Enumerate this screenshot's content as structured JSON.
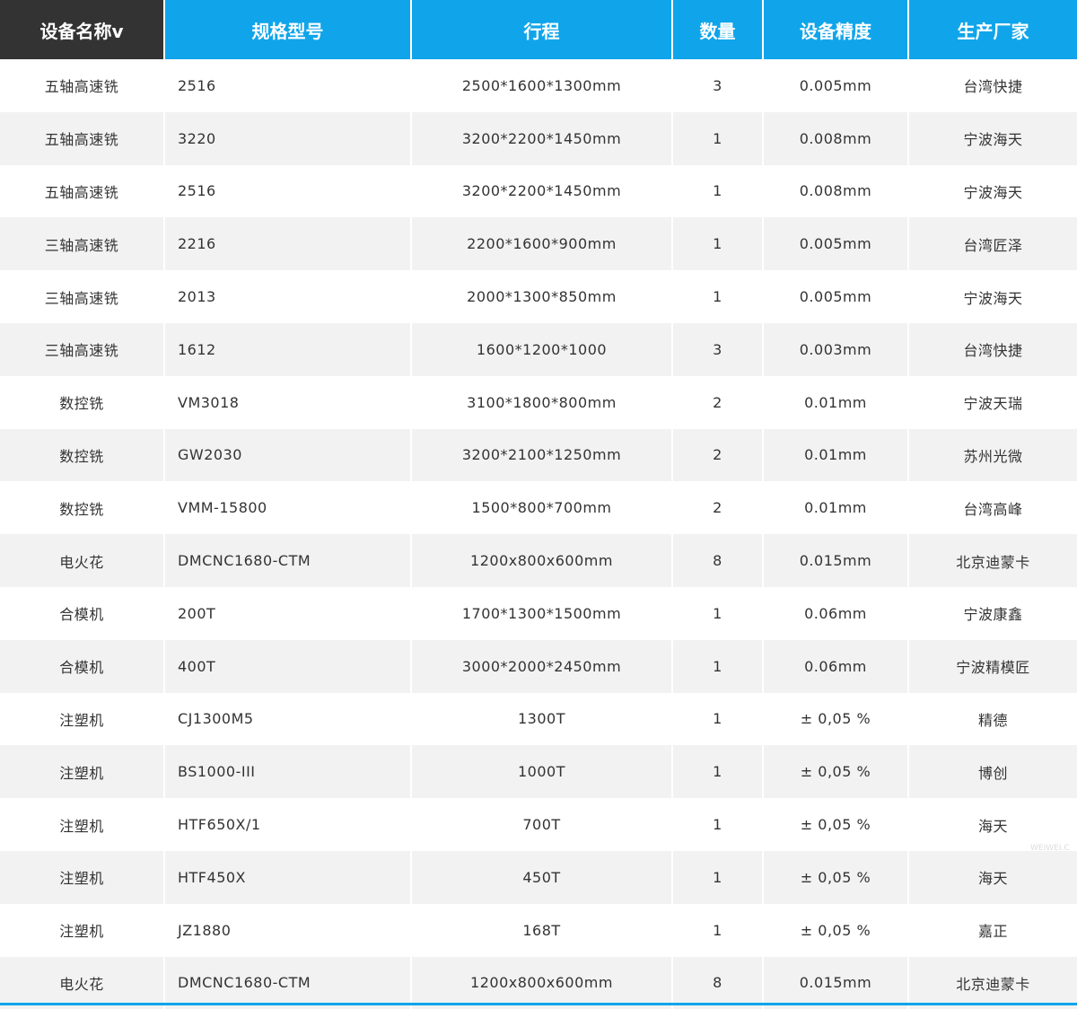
{
  "table": {
    "headers": [
      "设备名称v",
      "规格型号",
      "行程",
      "数量",
      "设备精度",
      "生产厂家"
    ],
    "rows": [
      [
        "五轴高速铣",
        "2516",
        "2500*1600*1300mm",
        "3",
        "0.005mm",
        "台湾快捷"
      ],
      [
        "五轴高速铣",
        "3220",
        "3200*2200*1450mm",
        "1",
        "0.008mm",
        "宁波海天"
      ],
      [
        "五轴高速铣",
        "2516",
        "3200*2200*1450mm",
        "1",
        "0.008mm",
        "宁波海天"
      ],
      [
        "三轴高速铣",
        "2216",
        "2200*1600*900mm",
        "1",
        "0.005mm",
        "台湾匠泽"
      ],
      [
        "三轴高速铣",
        "2013",
        "2000*1300*850mm",
        "1",
        "0.005mm",
        "宁波海天"
      ],
      [
        "三轴高速铣",
        "1612",
        "1600*1200*1000",
        "3",
        "0.003mm",
        "台湾快捷"
      ],
      [
        "数控铣",
        "VM3018",
        "3100*1800*800mm",
        "2",
        "0.01mm",
        "宁波天瑞"
      ],
      [
        "数控铣",
        "GW2030",
        "3200*2100*1250mm",
        "2",
        "0.01mm",
        "苏州光微"
      ],
      [
        "数控铣",
        "VMM-15800",
        "1500*800*700mm",
        "2",
        "0.01mm",
        "台湾高峰"
      ],
      [
        "电火花",
        "DMCNC1680-CTM",
        "1200x800x600mm",
        "8",
        "0.015mm",
        "北京迪蒙卡"
      ],
      [
        "合模机",
        "200T",
        "1700*1300*1500mm",
        "1",
        "0.06mm",
        "宁波康鑫"
      ],
      [
        "合模机",
        "400T",
        "3000*2000*2450mm",
        "1",
        "0.06mm",
        "宁波精模匠"
      ],
      [
        "注塑机",
        "CJ1300M5",
        "1300T",
        "1",
        "± 0,05 %",
        "精德"
      ],
      [
        "注塑机",
        "BS1000-III",
        "1000T",
        "1",
        "± 0,05 %",
        "博创"
      ],
      [
        "注塑机",
        "HTF650X/1",
        "700T",
        "1",
        "± 0,05 %",
        "海天"
      ],
      [
        "注塑机",
        "HTF450X",
        "450T",
        "1",
        "± 0,05 %",
        "海天"
      ],
      [
        "注塑机",
        "JZ1880",
        "168T",
        "1",
        "± 0,05 %",
        "嘉正"
      ],
      [
        "电火花",
        "DMCNC1680-CTM",
        "1200x800x600mm",
        "8",
        "0.015mm",
        "北京迪蒙卡"
      ]
    ]
  },
  "watermark": "WEIWEI.C",
  "colors": {
    "header_accent": "#10a5ea",
    "header_first": "#333333",
    "row_alt": "#f2f2f2",
    "text": "#333333"
  }
}
